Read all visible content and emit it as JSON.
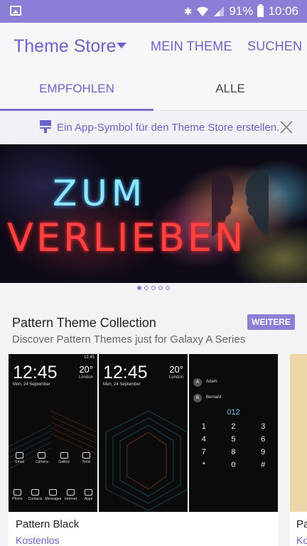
{
  "status_bar": {
    "battery": "91%",
    "time": "10:06"
  },
  "app_bar": {
    "title": "Theme Store",
    "actions": [
      "MEIN THEME",
      "SUCHEN"
    ]
  },
  "tabs": [
    {
      "label": "EMPFOHLEN",
      "selected": true
    },
    {
      "label": "ALLE",
      "selected": false
    }
  ],
  "notice": {
    "text": "Ein App-Symbol für den Theme Store erstellen."
  },
  "hero": {
    "line1": "ZUM",
    "line2": "VERLIEBEN",
    "page_count": 5,
    "active_page": 1
  },
  "section": {
    "title": "Pattern Theme Collection",
    "subtitle": "Discover Pattern Themes just for Galaxy A Series",
    "more_label": "WEITERE"
  },
  "cards": [
    {
      "name": "Pattern Black",
      "price": "Kostenlos",
      "preview": {
        "clock": "12:45",
        "temp": "20°",
        "date": "Mon, 24 September",
        "location": "London",
        "apps_row1": [
          "Email",
          "Camera",
          "Gallery",
          "Tools"
        ],
        "apps_row2": [
          "Phone",
          "Contacts",
          "Messages",
          "Internet",
          "Apps"
        ],
        "contacts": [
          {
            "initial": "A",
            "name": "Adam"
          },
          {
            "initial": "B",
            "name": "Bernard"
          }
        ],
        "dial_number": "012",
        "keys": [
          "1",
          "2",
          "3",
          "4",
          "5",
          "6",
          "7",
          "8",
          "9",
          "*",
          "0",
          "#"
        ]
      }
    },
    {
      "name": "Pa",
      "price": "Ko"
    }
  ],
  "colors": {
    "accent": "#6d62c9",
    "status_bar": "#8a7fd6"
  }
}
